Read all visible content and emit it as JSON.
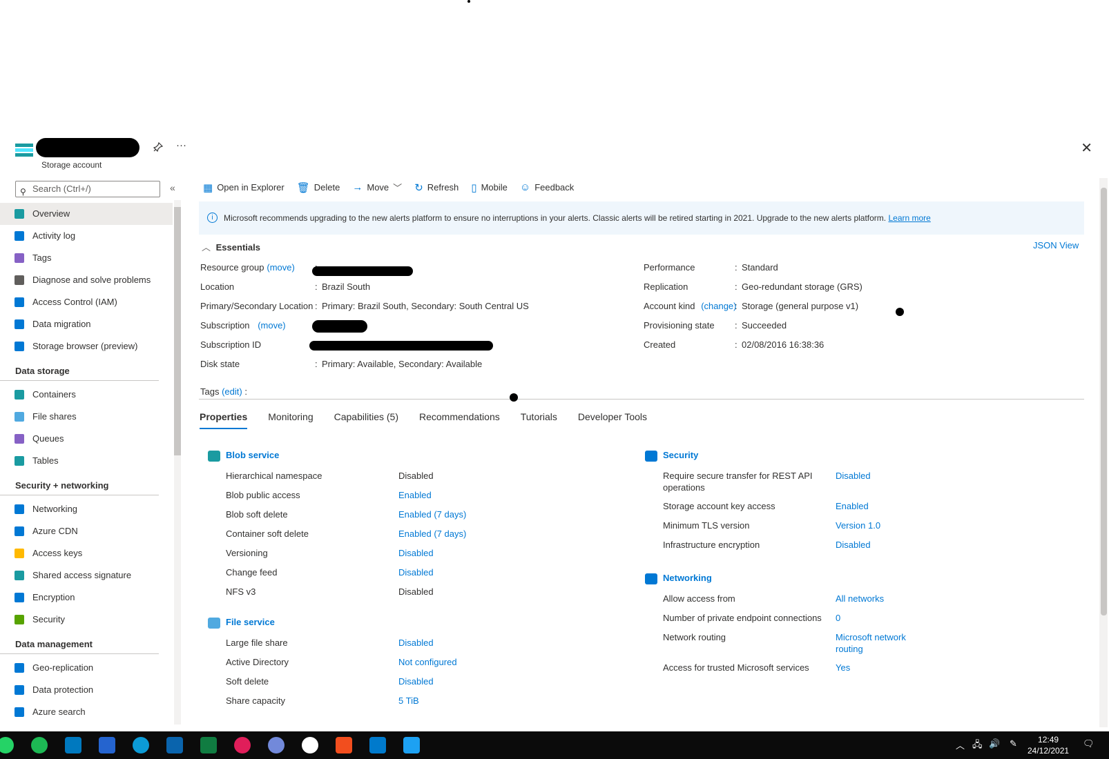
{
  "header": {
    "resource_type": "Storage account",
    "pin_icon": "pin-icon",
    "more": "···",
    "close": "✕"
  },
  "sidebar": {
    "search_placeholder": "Search (Ctrl+/)",
    "collapse": "«",
    "items": [
      {
        "label": "Overview",
        "icon": "overview-icon",
        "color": "#1a9ba1",
        "active": true
      },
      {
        "label": "Activity log",
        "icon": "activity-log-icon",
        "color": "#0078d4"
      },
      {
        "label": "Tags",
        "icon": "tag-icon",
        "color": "#8661c5"
      },
      {
        "label": "Diagnose and solve problems",
        "icon": "wrench-icon",
        "color": "#605e5c"
      },
      {
        "label": "Access Control (IAM)",
        "icon": "people-icon",
        "color": "#0078d4"
      },
      {
        "label": "Data migration",
        "icon": "data-migration-icon",
        "color": "#0078d4"
      },
      {
        "label": "Storage browser (preview)",
        "icon": "storage-browser-icon",
        "color": "#0078d4"
      }
    ],
    "sections": [
      {
        "title": "Data storage",
        "items": [
          {
            "label": "Containers",
            "icon": "containers-icon",
            "color": "#1a9ba1"
          },
          {
            "label": "File shares",
            "icon": "file-shares-icon",
            "color": "#50a9e0"
          },
          {
            "label": "Queues",
            "icon": "queues-icon",
            "color": "#8661c5"
          },
          {
            "label": "Tables",
            "icon": "tables-icon",
            "color": "#1a9ba1"
          }
        ]
      },
      {
        "title": "Security + networking",
        "items": [
          {
            "label": "Networking",
            "icon": "networking-icon",
            "color": "#0078d4"
          },
          {
            "label": "Azure CDN",
            "icon": "cloud-icon",
            "color": "#0078d4"
          },
          {
            "label": "Access keys",
            "icon": "key-icon",
            "color": "#ffb900"
          },
          {
            "label": "Shared access signature",
            "icon": "link-icon",
            "color": "#1a9ba1"
          },
          {
            "label": "Encryption",
            "icon": "lock-icon",
            "color": "#0078d4"
          },
          {
            "label": "Security",
            "icon": "shield-icon",
            "color": "#57a300"
          }
        ]
      },
      {
        "title": "Data management",
        "items": [
          {
            "label": "Geo-replication",
            "icon": "globe-icon",
            "color": "#0078d4"
          },
          {
            "label": "Data protection",
            "icon": "shield-icon",
            "color": "#0078d4"
          },
          {
            "label": "Azure search",
            "icon": "cloud-search-icon",
            "color": "#0078d4"
          }
        ]
      }
    ]
  },
  "toolbar": {
    "items": [
      {
        "label": "Open in Explorer",
        "icon": "explorer-icon"
      },
      {
        "label": "Delete",
        "icon": "trash-icon"
      },
      {
        "label": "Move",
        "icon": "arrow-right-icon",
        "dropdown": true
      },
      {
        "label": "Refresh",
        "icon": "refresh-icon"
      },
      {
        "label": "Mobile",
        "icon": "mobile-icon"
      },
      {
        "label": "Feedback",
        "icon": "feedback-icon"
      }
    ]
  },
  "banner": {
    "text": "Microsoft recommends upgrading to the new alerts platform to ensure no interruptions in your alerts. Classic alerts will be retired starting in 2021. Upgrade to the new alerts platform.",
    "link": "Learn more"
  },
  "essentials": {
    "title": "Essentials",
    "json_view": "JSON View",
    "left": [
      {
        "label": "Resource group",
        "action": "(move)",
        "value": ""
      },
      {
        "label": "Location",
        "value": "Brazil South"
      },
      {
        "label": "Primary/Secondary Location",
        "value": "Primary: Brazil South, Secondary: South Central US"
      },
      {
        "label": "Subscription",
        "action": "(move)",
        "value": ""
      },
      {
        "label": "Subscription ID",
        "value": ""
      },
      {
        "label": "Disk state",
        "value": "Primary: Available, Secondary: Available"
      }
    ],
    "right": [
      {
        "label": "Performance",
        "value": "Standard"
      },
      {
        "label": "Replication",
        "value": "Geo-redundant storage (GRS)"
      },
      {
        "label": "Account kind",
        "action": "(change)",
        "value": "Storage (general purpose v1)"
      },
      {
        "label": "Provisioning state",
        "value": "Succeeded"
      },
      {
        "label": "Created",
        "value": "02/08/2016 16:38:36"
      }
    ],
    "tags_label": "Tags",
    "tags_action": "(edit)"
  },
  "tabs": [
    "Properties",
    "Monitoring",
    "Capabilities (5)",
    "Recommendations",
    "Tutorials",
    "Developer Tools"
  ],
  "properties": {
    "blob": {
      "title": "Blob service",
      "rows": [
        {
          "label": "Hierarchical namespace",
          "value": "Disabled",
          "link": false
        },
        {
          "label": "Blob public access",
          "value": "Enabled",
          "link": true
        },
        {
          "label": "Blob soft delete",
          "value": "Enabled (7 days)",
          "link": true
        },
        {
          "label": "Container soft delete",
          "value": "Enabled (7 days)",
          "link": true
        },
        {
          "label": "Versioning",
          "value": "Disabled",
          "link": true
        },
        {
          "label": "Change feed",
          "value": "Disabled",
          "link": true
        },
        {
          "label": "NFS v3",
          "value": "Disabled",
          "link": false
        }
      ]
    },
    "file": {
      "title": "File service",
      "rows": [
        {
          "label": "Large file share",
          "value": "Disabled",
          "link": true
        },
        {
          "label": "Active Directory",
          "value": "Not configured",
          "link": true
        },
        {
          "label": "Soft delete",
          "value": "Disabled",
          "link": true
        },
        {
          "label": "Share capacity",
          "value": "5 TiB",
          "link": true
        }
      ]
    },
    "security": {
      "title": "Security",
      "rows": [
        {
          "label": "Require secure transfer for REST API",
          "label2": "operations",
          "value": "Disabled"
        },
        {
          "label": "Storage account key access",
          "value": "Enabled"
        },
        {
          "label": "Minimum TLS version",
          "value": "Version 1.0"
        },
        {
          "label": "Infrastructure encryption",
          "value": "Disabled"
        }
      ]
    },
    "networking": {
      "title": "Networking",
      "rows": [
        {
          "label": "Allow access from",
          "value": "All networks"
        },
        {
          "label": "Number of private endpoint connections",
          "value": "0"
        },
        {
          "label": "Network routing",
          "value": "Microsoft network",
          "value2": "routing"
        },
        {
          "label": "Access for trusted Microsoft services",
          "value": "Yes"
        }
      ]
    }
  },
  "taskbar": {
    "apps": [
      {
        "name": "whatsapp-icon",
        "color": "#25d366"
      },
      {
        "name": "spotify-icon",
        "color": "#1db954"
      },
      {
        "name": "trello-icon",
        "color": "#0079bf"
      },
      {
        "name": "todo-icon",
        "color": "#2564cf"
      },
      {
        "name": "edge-icon",
        "color": "#0c9bd6"
      },
      {
        "name": "outlook-icon",
        "color": "#0a64ad"
      },
      {
        "name": "excel-icon",
        "color": "#107c41"
      },
      {
        "name": "slack-icon",
        "color": "#e01e5a"
      },
      {
        "name": "discord-icon",
        "color": "#7289da"
      },
      {
        "name": "mongodb-icon",
        "color": "#ffffff"
      },
      {
        "name": "figma-icon",
        "color": "#f24e1e"
      },
      {
        "name": "vscode-icon",
        "color": "#007acc"
      },
      {
        "name": "twitter-icon",
        "color": "#1da1f2"
      }
    ],
    "time": "12:49",
    "date": "24/12/2021"
  }
}
